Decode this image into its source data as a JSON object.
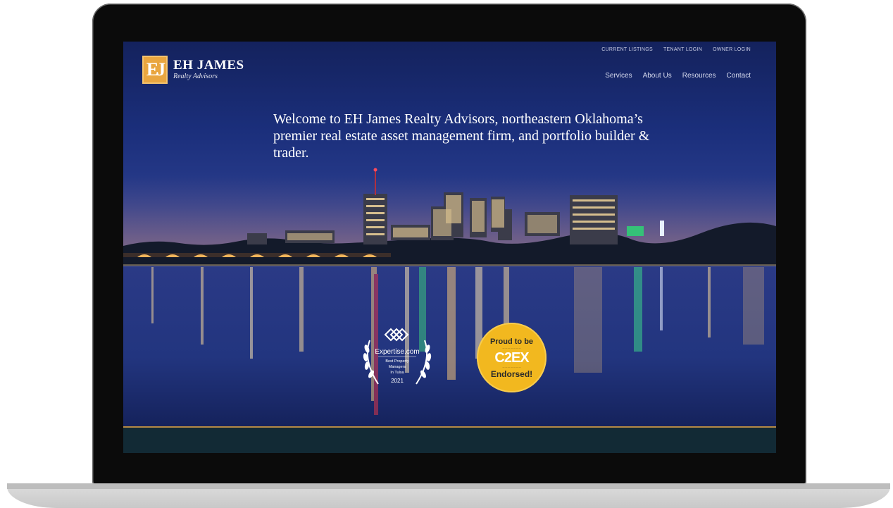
{
  "site": {
    "logo_mark": "EJ",
    "logo_name": "EH JAMES",
    "logo_tagline": "Realty Advisors"
  },
  "top_nav": [
    {
      "label": "CURRENT LISTINGS"
    },
    {
      "label": "TENANT LOGIN"
    },
    {
      "label": "OWNER LOGIN"
    }
  ],
  "main_nav": [
    {
      "label": "Services"
    },
    {
      "label": "About Us"
    },
    {
      "label": "Resources"
    },
    {
      "label": "Contact"
    }
  ],
  "hero": {
    "headline": "Welcome to EH James Realty Advisors, northeastern Oklahoma’s premier real estate asset management firm, and portfolio builder & trader."
  },
  "badges": {
    "expertise": {
      "brand": "Expertise.com",
      "line1": "Best Property",
      "line2": "Managers",
      "line3": "In Tulsa",
      "year": "2021"
    },
    "c2ex": {
      "top": "Proud to be",
      "logo": "C2EX",
      "bottom": "Endorsed!"
    }
  },
  "colors": {
    "accent_gold": "#e9a640",
    "footer_band": "#122a35",
    "footer_rule": "#b58a45"
  }
}
